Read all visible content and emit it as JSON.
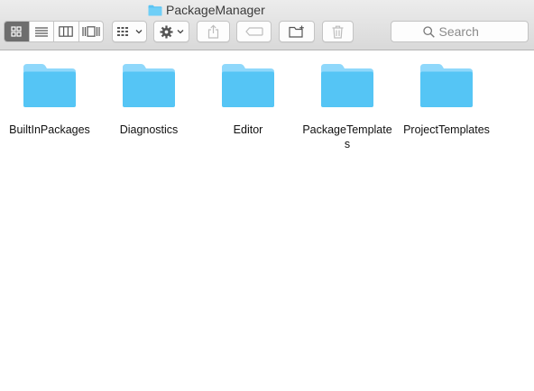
{
  "window": {
    "title": "PackageManager",
    "title_icon": "folder-icon"
  },
  "toolbar": {
    "view_buttons": [
      {
        "name": "icon-view",
        "icon": "grid-icon",
        "active": true
      },
      {
        "name": "list-view",
        "icon": "list-icon",
        "active": false
      },
      {
        "name": "column-view",
        "icon": "columns-icon",
        "active": false
      },
      {
        "name": "cover-flow-view",
        "icon": "cover-flow-icon",
        "active": false
      }
    ],
    "arrange_icon": "arrange-grid-icon",
    "action_icon": "gear-icon",
    "share_icon": "share-icon",
    "tags_icon": "tag-icon",
    "new_folder_icon": "new-folder-icon",
    "trash_icon": "trash-icon",
    "search_placeholder": "Search"
  },
  "items": [
    {
      "label": "BuiltInPackages",
      "icon": "folder-icon"
    },
    {
      "label": "Diagnostics",
      "icon": "folder-icon"
    },
    {
      "label": "Editor",
      "icon": "folder-icon"
    },
    {
      "label": "PackageTemplates",
      "icon": "folder-icon"
    },
    {
      "label": "ProjectTemplates",
      "icon": "folder-icon"
    }
  ],
  "colors": {
    "folder_light": "#8fd8fb",
    "folder_main": "#55c5f5",
    "active_segment": "#6e6e6e"
  }
}
